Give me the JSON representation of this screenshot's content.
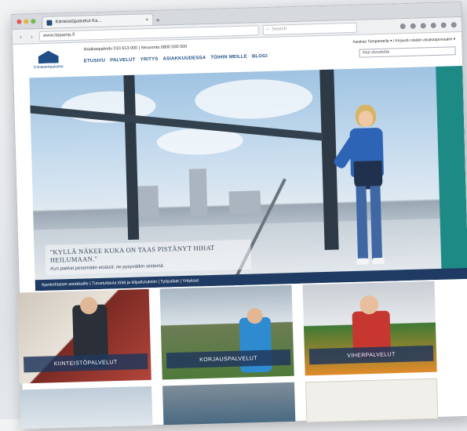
{
  "browser": {
    "tab_title": "Kiinteistöpalvelut Ka...",
    "url": "www.itapamp.fi",
    "search_placeholder": "Search",
    "colors": {
      "chrome": "#d6d9dd",
      "toolbar": "#eef0f2"
    }
  },
  "site": {
    "logo_text": "Kiinteistöpalvelut",
    "contact_line": "Asiakaspalvelu 010 613 000 | Neuvonta 0800 000 000",
    "top_links": "Asiakas Tampereella ▾ | Kirjaudu sisään asiakasportaaliin ▾",
    "search_placeholder": "Hae sivustolta",
    "nav": [
      "ETUSIVU",
      "PALVELUT",
      "YRITYS",
      "ASIAKKUUDESSA",
      "TÖIHIN MEILLE",
      "BLOGI"
    ],
    "brand_color": "#1f4f86"
  },
  "hero": {
    "quote": "\"KYLLÄ NÄKEE KUKA ON TAAS PISTÄNYT HIHAT HEILUMAAN.\"",
    "subquote": "Kun pakkat pesemään etulasit, ne pysyvätkin siisteinä.",
    "breadcrumb": "Ajankohtaiset asiakkaille | Tutustuttavia töitä ja kilpailutuksiin | Työpaikat | Yritykset"
  },
  "services": [
    {
      "label": "KIINTEISTÖPALVELUT"
    },
    {
      "label": "KORJAUSPALVELUT"
    },
    {
      "label": "VIHERPALVELUT"
    }
  ]
}
